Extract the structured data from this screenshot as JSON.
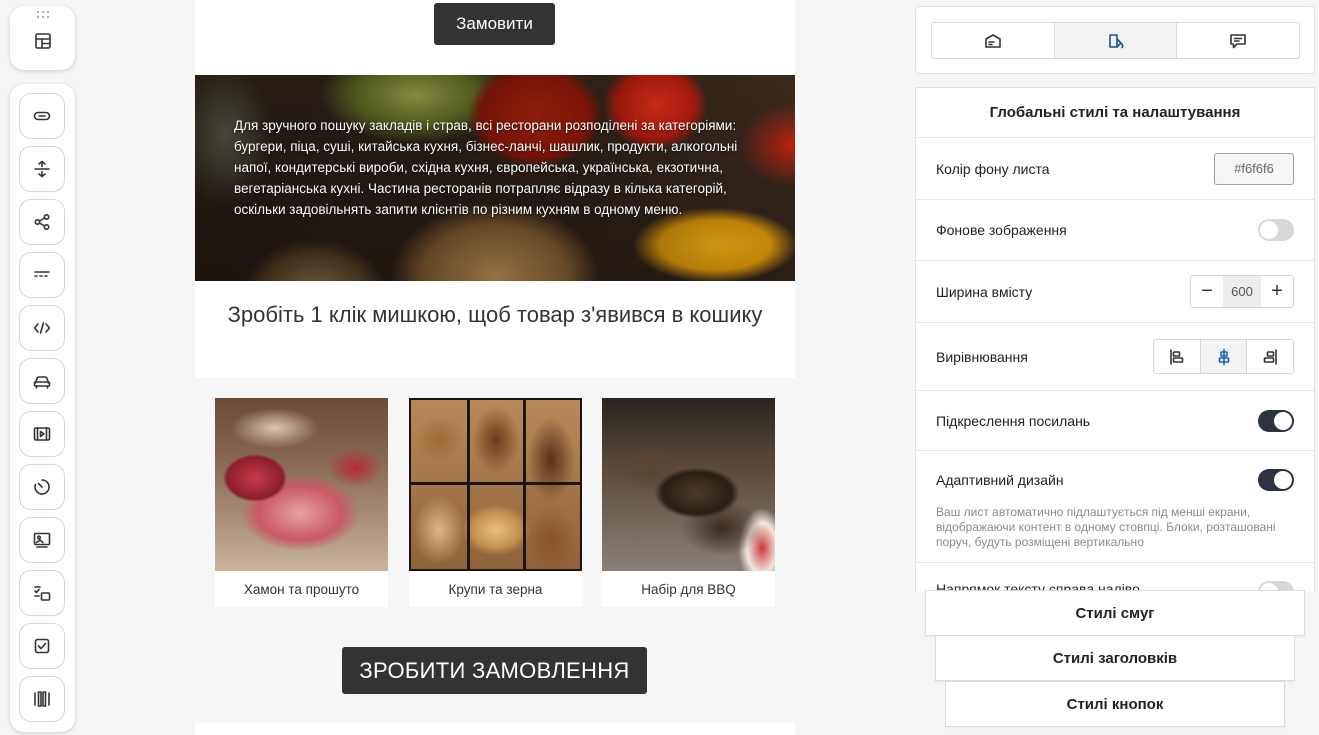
{
  "toolbar": {
    "top_tool": "layout-icon",
    "tools": [
      "button-icon",
      "spacer-icon",
      "share-icon",
      "divider-icon",
      "code-icon",
      "car-icon",
      "video-icon",
      "timer-icon",
      "image-text-icon",
      "checklist-icon",
      "checkbox-icon",
      "columns-icon"
    ]
  },
  "email": {
    "order_button": "Замовити",
    "hero_text": "Для зручного пошуку закладів і страв, всі ресторани розподілені за категоріями: бургери, піца, суші, китайська кухня, бізнес-ланчі, шашлик, продукти, алкогольні напої, кондитерські вироби, східна кухня, європейська, українська, екзотична, вегетаріанська кухні. Частина ресторанів потрапляє відразу в кілька категорій, оскільки задовільнять запити клієнтів по різним кухням в одному меню.",
    "heading": "Зробіть 1 клік мишкою, щоб товар з'явився в кошику",
    "products": [
      {
        "caption": "Хамон та прошуто"
      },
      {
        "caption": "Крупи та зерна"
      },
      {
        "caption": "Набір для BBQ"
      }
    ],
    "cta": "ЗРОБИТИ ЗАМОВЛЕННЯ"
  },
  "panel": {
    "tabs": [
      {
        "icon": "envelope-icon",
        "active": false
      },
      {
        "icon": "paint-bucket-icon",
        "active": true
      },
      {
        "icon": "comment-icon",
        "active": false
      }
    ],
    "title": "Глобальні стилі та налаштування",
    "bg_color_label": "Колір фону листа",
    "bg_color_value": "#f6f6f6",
    "bg_image_label": "Фонове зображення",
    "bg_image_on": false,
    "width_label": "Ширина вмісту",
    "width_value": "600",
    "align_label": "Вирівнювання",
    "align_selected": "center",
    "link_underline_label": "Підкреслення посилань",
    "link_underline_on": true,
    "adaptive_label": "Адаптивний дизайн",
    "adaptive_on": true,
    "adaptive_desc": "Ваш лист автоматично підлаштується під менші екрани, відображаючи контент в одному стовпці. Блоки, розташовані поруч, будуть розміщені вертикально",
    "rtl_label": "Напрямок тексту справа наліво",
    "rtl_on": false
  },
  "sections": {
    "strips": "Стилі смуг",
    "headings": "Стилі заголовків",
    "buttons": "Стилі кнопок"
  },
  "colors": {
    "dark_button": "#333333",
    "toggle_on": "#2d3340",
    "accent": "#1d5fb0",
    "page_bg": "#f6f6f6"
  }
}
